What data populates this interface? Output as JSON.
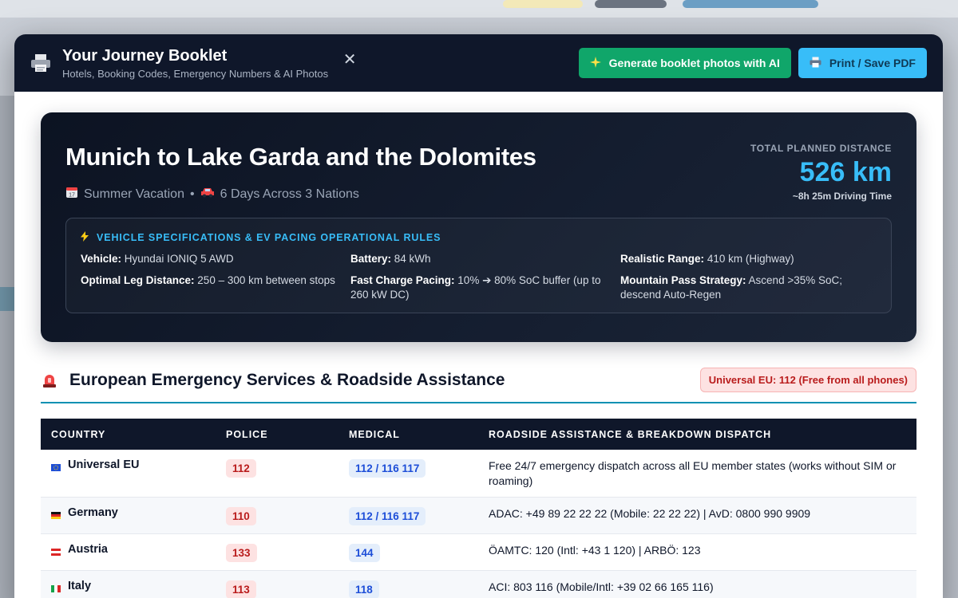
{
  "header": {
    "icon": "printer-icon",
    "title": "Your Journey Booklet",
    "subtitle": "Hotels, Booking Codes, Emergency Numbers & AI Photos",
    "close_label": "✕",
    "ai_button": "Generate booklet photos with AI",
    "ai_button_icon": "sparkles-icon",
    "print_button": "Print / Save PDF",
    "print_button_icon": "printer-icon"
  },
  "hero": {
    "title": "Munich to Lake Garda and the Dolomites",
    "season": "Summer Vacation",
    "separator": "•",
    "trip": "6 Days Across 3 Nations",
    "distance_label": "TOTAL PLANNED DISTANCE",
    "distance": "526 km",
    "driving_time": "~8h 25m Driving Time"
  },
  "specs": {
    "heading": "VEHICLE SPECIFICATIONS & EV PACING OPERATIONAL RULES",
    "items": [
      {
        "label": "Vehicle:",
        "value": "Hyundai IONIQ 5 AWD"
      },
      {
        "label": "Battery:",
        "value": "84 kWh"
      },
      {
        "label": "Realistic Range:",
        "value": "410 km (Highway)"
      },
      {
        "label": "Optimal Leg Distance:",
        "value": "250 – 300 km between stops"
      },
      {
        "label": "Fast Charge Pacing:",
        "value": "10% ➔ 80% SoC buffer (up to 260 kW DC)"
      },
      {
        "label": "Mountain Pass Strategy:",
        "value": "Ascend >35% SoC; descend Auto-Regen"
      }
    ]
  },
  "emergency": {
    "title": "European Emergency Services & Roadside Assistance",
    "badge": "Universal EU: 112 (Free from all phones)",
    "columns": [
      "COUNTRY",
      "POLICE",
      "MEDICAL",
      "ROADSIDE ASSISTANCE & BREAKDOWN DISPATCH"
    ],
    "rows": [
      {
        "country": "Universal EU",
        "flag": "eu",
        "police": "112",
        "medical": "112 / 116 117",
        "roadside": "Free 24/7 emergency dispatch across all EU member states (works without SIM or roaming)"
      },
      {
        "country": "Germany",
        "flag": "de",
        "police": "110",
        "medical": "112 / 116 117",
        "roadside": "ADAC: +49 89 22 22 22 (Mobile: 22 22 22) | AvD: 0800 990 9909"
      },
      {
        "country": "Austria",
        "flag": "at",
        "police": "133",
        "medical": "144",
        "roadside": "ÖAMTC: 120 (Intl: +43 1 120) | ARBÖ: 123"
      },
      {
        "country": "Italy",
        "flag": "it",
        "police": "113",
        "medical": "118",
        "roadside": "ACI: 803 116 (Mobile/Intl: +39 02 66 165 116)"
      }
    ]
  },
  "colors": {
    "header_bg": "#0f172a",
    "accent_blue": "#38bdf8",
    "ai_green": "#10a66a",
    "alert_red": "#b91c1c"
  }
}
